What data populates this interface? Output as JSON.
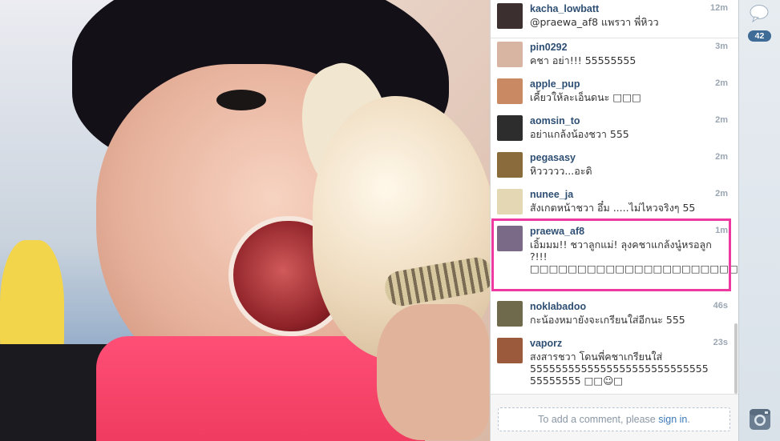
{
  "comments": [
    {
      "user": "kacha_lowbatt",
      "text": "@praewa_af8 แพรวา พี่หิวว",
      "time": "12m",
      "avatar_color": "#3b2f2f"
    },
    {
      "user": "pin0292",
      "text": "คชา อย่า!!! 55555555",
      "time": "3m",
      "avatar_color": "#d8b4a2"
    },
    {
      "user": "apple_pup",
      "text": "เคี้ยวให้ละเอ็นดนะ □□□",
      "time": "2m",
      "avatar_color": "#c98a63"
    },
    {
      "user": "aomsin_to",
      "text": "อย่าแกล้งน้องชวา 555",
      "time": "2m",
      "avatar_color": "#2d2d2d"
    },
    {
      "user": "pegasasy",
      "text": "หิววววว...อะดิ",
      "time": "2m",
      "avatar_color": "#8a6b3b"
    },
    {
      "user": "nunee_ja",
      "text": "สังเกตหน้าชวา อึ๋ม .....ไม่ไหวจริงๆ 55",
      "time": "2m",
      "avatar_color": "#e4d7b4"
    },
    {
      "user": "praewa_af8",
      "text": "เอิ้มมม!! ชวาลูกแม่! ลุงคชาแกล้งนู๋หรอลูก ?!!! □□□□□□□□□□□□□□□□□□□□□□□",
      "time": "1m",
      "avatar_color": "#7a6a88"
    },
    {
      "user": "noklabadoo",
      "text": "กะน้องหมายังจะเกรียนใส่อีกนะ 555",
      "time": "46s",
      "avatar_color": "#6f6a4c"
    },
    {
      "user": "vaporz",
      "text": "สงสารชวา โดนพี่คชาเกรียนใส่ 5555555555555555555555555555 55555555 □□☺□",
      "time": "23s",
      "avatar_color": "#9c5a3c"
    }
  ],
  "comment_input": {
    "prefix": "To add a comment, please ",
    "link": "sign in",
    "suffix": "."
  },
  "rail": {
    "comment_count": "42"
  },
  "colors": {
    "username": "#2e4f73",
    "highlight": "#ee3aa0",
    "badge": "#3f6b97"
  }
}
